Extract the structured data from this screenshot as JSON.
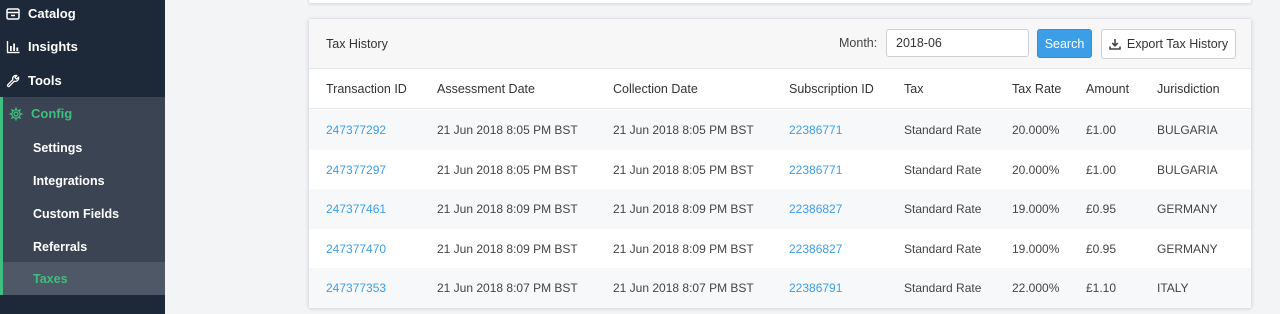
{
  "sidebar": {
    "items": [
      {
        "label": "Catalog",
        "icon": "catalog-icon"
      },
      {
        "label": "Insights",
        "icon": "bar-chart-icon"
      },
      {
        "label": "Tools",
        "icon": "wrench-icon"
      },
      {
        "label": "Config",
        "icon": "gear-icon"
      }
    ],
    "config_items": [
      "Settings",
      "Integrations",
      "Custom Fields",
      "Referrals",
      "Taxes"
    ],
    "active_item": "Taxes",
    "accent_color": "#3fbf7f"
  },
  "panel": {
    "title": "Tax History",
    "month_label": "Month:",
    "month_value": "2018-06",
    "search_label": "Search",
    "export_label": "Export Tax History"
  },
  "table": {
    "columns": [
      "Transaction ID",
      "Assessment Date",
      "Collection Date",
      "Subscription ID",
      "Tax",
      "Tax Rate",
      "Amount",
      "Jurisdiction"
    ],
    "rows": [
      {
        "transaction_id": "247377292",
        "assessment_date": "21 Jun 2018 8:05 PM BST",
        "collection_date": "21 Jun 2018 8:05 PM BST",
        "subscription_id": "22386771",
        "tax": "Standard Rate",
        "tax_rate": "20.000%",
        "amount": "£1.00",
        "jurisdiction": "BULGARIA"
      },
      {
        "transaction_id": "247377297",
        "assessment_date": "21 Jun 2018 8:05 PM BST",
        "collection_date": "21 Jun 2018 8:05 PM BST",
        "subscription_id": "22386771",
        "tax": "Standard Rate",
        "tax_rate": "20.000%",
        "amount": "£1.00",
        "jurisdiction": "BULGARIA"
      },
      {
        "transaction_id": "247377461",
        "assessment_date": "21 Jun 2018 8:09 PM BST",
        "collection_date": "21 Jun 2018 8:09 PM BST",
        "subscription_id": "22386827",
        "tax": "Standard Rate",
        "tax_rate": "19.000%",
        "amount": "£0.95",
        "jurisdiction": "GERMANY"
      },
      {
        "transaction_id": "247377470",
        "assessment_date": "21 Jun 2018 8:09 PM BST",
        "collection_date": "21 Jun 2018 8:09 PM BST",
        "subscription_id": "22386827",
        "tax": "Standard Rate",
        "tax_rate": "19.000%",
        "amount": "£0.95",
        "jurisdiction": "GERMANY"
      },
      {
        "transaction_id": "247377353",
        "assessment_date": "21 Jun 2018 8:07 PM BST",
        "collection_date": "21 Jun 2018 8:07 PM BST",
        "subscription_id": "22386791",
        "tax": "Standard Rate",
        "tax_rate": "22.000%",
        "amount": "£1.10",
        "jurisdiction": "ITALY"
      }
    ]
  },
  "colors": {
    "sidebar_bg": "#1d2838",
    "link": "#3d9ee8",
    "button_primary": "#3d9ee8"
  }
}
